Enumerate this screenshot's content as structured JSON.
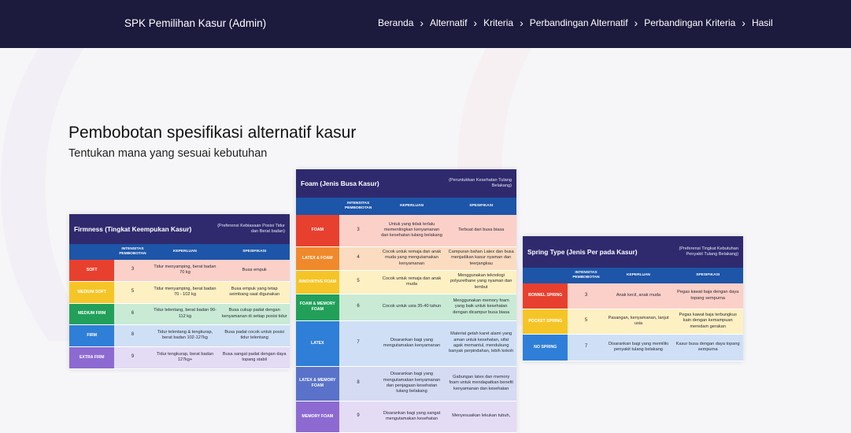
{
  "navbar": {
    "brand": "SPK Pemilihan Kasur (Admin)",
    "links": [
      "Beranda",
      "Alternatif",
      "Kriteria",
      "Perbandingan Alternatif",
      "Perbandingan Kriteria",
      "Hasil"
    ]
  },
  "page": {
    "title": "Pembobotan spesifikasi alternatif kasur",
    "subtitle": "Tentukan mana yang sesuai kebutuhan"
  },
  "colors": {
    "navbar": "#1c1a3d",
    "card_header": "#2f2a6e",
    "table_header": "#1d55a8"
  },
  "cards": {
    "firmness": {
      "title": "Firmness (Tingkat Keempukan Kasur)",
      "note": "(Preferensi Kebiasaan Posisi Tidur dan Berat badan)",
      "headers": [
        "",
        "INTENSITAS PEMBOBOTAN",
        "KEPERLUAN",
        "SPESIFIKASI"
      ],
      "rows": [
        {
          "cat": "SOFT",
          "level": "3",
          "need": "Tidur menyamping, berat badan 70 kg",
          "spec": "Busa empuk",
          "cat_color": "#e8402f",
          "cell_color": "#fbd0c8"
        },
        {
          "cat": "MEDIUM SOFT",
          "level": "5",
          "need": "Tidur menyamping, berat badan 70 - 102 kg",
          "spec": "Busa empuk yang tetap seimbang saat digunakan",
          "cat_color": "#f5c527",
          "cell_color": "#fdf0c2"
        },
        {
          "cat": "MEDIUM FIRM",
          "level": "6",
          "need": "Tidur telentang, berat badan 90-112 kg",
          "spec": "Busa cukup padat dengan kenyamanan di setiap posisi tidur",
          "cat_color": "#22a05a",
          "cell_color": "#c9ead5"
        },
        {
          "cat": "FIRM",
          "level": "8",
          "need": "Tidur telentang & tengkurap, berat badan 102-127kg",
          "spec": "Busa padat cocok untuk posisi tidur telentang",
          "cat_color": "#2f7fd8",
          "cell_color": "#cfe0f6"
        },
        {
          "cat": "EXTRA FIRM",
          "level": "9",
          "need": "Tidur tengkurap, berat badan 127kg+",
          "spec": "Busa sangat padat dengan daya topang stabil",
          "cat_color": "#8d6ad1",
          "cell_color": "#e4dbf5"
        }
      ]
    },
    "foam": {
      "title": "Foam (Jenis Busa Kasur)",
      "note": "(Peruntukkan Kesehatan Tulang Belakang)",
      "headers": [
        "",
        "INTENSITAS PEMBOBOTAN",
        "KEPERLUAN",
        "SPESIFIKASI"
      ],
      "rows": [
        {
          "cat": "FOAM",
          "level": "3",
          "need": "Untuk yang tidak terlalu mementingkan kenyamanan dan kesehatan tulang belakang",
          "spec": "Terbuat dari busa biasa",
          "cat_color": "#e8402f",
          "cell_color": "#fbd0c8"
        },
        {
          "cat": "LATEX & FOAM",
          "level": "4",
          "need": "Cocok untuk remaja dan anak muda yang mengutamakan kenyamanan",
          "spec": "Campuran bahan Latex dan busa menjadikan kasur nyaman dan teerjangkau",
          "cat_color": "#f0892b",
          "cell_color": "#fbdcc0"
        },
        {
          "cat": "INNOVATIVE FOAM",
          "level": "5",
          "need": "Cocok untuk remaja dan anak muda",
          "spec": "Menggunakan teknologi polyurethane yang nyaman dan lembut",
          "cat_color": "#f5c527",
          "cell_color": "#fdf0c2"
        },
        {
          "cat": "FOAM & MEMORY FOAM",
          "level": "6",
          "need": "Cocok untuk usia 35-40 tahun",
          "spec": "Menggunakan memory foam yang baik untuk kesehatan dengan dicampur busa biasa",
          "cat_color": "#22a05a",
          "cell_color": "#c9ead5"
        },
        {
          "cat": "LATEX",
          "level": "7",
          "need": "Disarankan bagi yang mengutamakan kenyamanan",
          "spec": "Material getah karet alami yang aman untuk kesehatan, sifat agak memantul, mendukung banyak perpindahan, lebih kokoh",
          "cat_color": "#2f7fd8",
          "cell_color": "#cfe0f6"
        },
        {
          "cat": "LATEX & MEMORY FOAM",
          "level": "8",
          "need": "Disarankan bagi yang mengutamakan kenyamanan dan penjagaan kesehatan tulang belakang",
          "spec": "Gabungan latex dan memory foam untuk mendapatkan benefit kenyamanan dan kesehatan",
          "cat_color": "#5a72c9",
          "cell_color": "#d4dbf2"
        },
        {
          "cat": "MEMORY FOAM",
          "level": "9",
          "need": "Disarankan bagi yang sangat mengutamakan kesehatan",
          "spec": "Menyesuaikan lekukan tubuh,",
          "cat_color": "#8d6ad1",
          "cell_color": "#e4dbf5"
        }
      ]
    },
    "spring": {
      "title": "Spring Type (Jenis Per pada Kasur)",
      "note": "(Preferensi Tingkat Kebutuhan Penyakit Tulang Belakang)",
      "headers": [
        "",
        "INTENSITAS PEMBOBOTAN",
        "KEPERLUAN",
        "SPESIFIKASI"
      ],
      "rows": [
        {
          "cat": "BONNEL SPRING",
          "level": "3",
          "need": "Anak kecil, anak muda",
          "spec": "Pegas kawat baja dengan daya topang sempurna",
          "cat_color": "#e8402f",
          "cell_color": "#fbd0c8"
        },
        {
          "cat": "POCKET SPRING",
          "level": "5",
          "need": "Pasangan, kenyamanan, lanjut usia",
          "spec": "Pegas kawat baja terbungkus kain dengan kemampuan meredam gerakan",
          "cat_color": "#f5c527",
          "cell_color": "#fdf0c2"
        },
        {
          "cat": "NO SPRING",
          "level": "7",
          "need": "Disarankan bagi yang memiliki penyakit tulang belakang",
          "spec": "Kasur busa dengan daya topang sempurna",
          "cat_color": "#2f7fd8",
          "cell_color": "#cfe0f6"
        }
      ]
    }
  }
}
